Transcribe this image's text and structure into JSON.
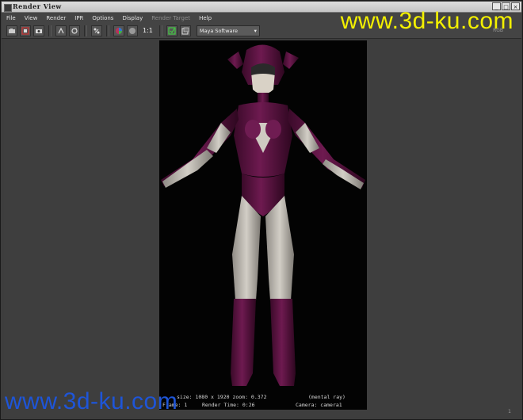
{
  "window": {
    "title": "Render View"
  },
  "window_buttons": [
    "_",
    "□",
    "×"
  ],
  "menubar": {
    "items": [
      {
        "label": "File",
        "disabled": false
      },
      {
        "label": "View",
        "disabled": false
      },
      {
        "label": "Render",
        "disabled": false
      },
      {
        "label": "IPR",
        "disabled": false
      },
      {
        "label": "Options",
        "disabled": false
      },
      {
        "label": "Display",
        "disabled": false
      },
      {
        "label": "Render Target",
        "disabled": true
      },
      {
        "label": "Help",
        "disabled": false
      }
    ]
  },
  "toolbar": {
    "ratio_label": "1:1",
    "renderer": "Maya Software"
  },
  "render_info": {
    "line1": "size: 1080 x 1920 zoom: 0.372",
    "line1_right": "(mental ray)",
    "line2_left": "Frame: 1",
    "line2": "Render Time: 0:26",
    "line2_right": "Camera: camera1"
  },
  "corner_labels": {
    "top_right": "RGB",
    "bottom_right": "1"
  },
  "watermarks": {
    "top": "www.3d-ku.com",
    "bottom": "www.3d-ku.com"
  },
  "colors": {
    "watermark_top": "#f3f000",
    "watermark_bottom": "#1e55d8",
    "suit": "#5a1140",
    "skin": "#c9c5bd"
  }
}
